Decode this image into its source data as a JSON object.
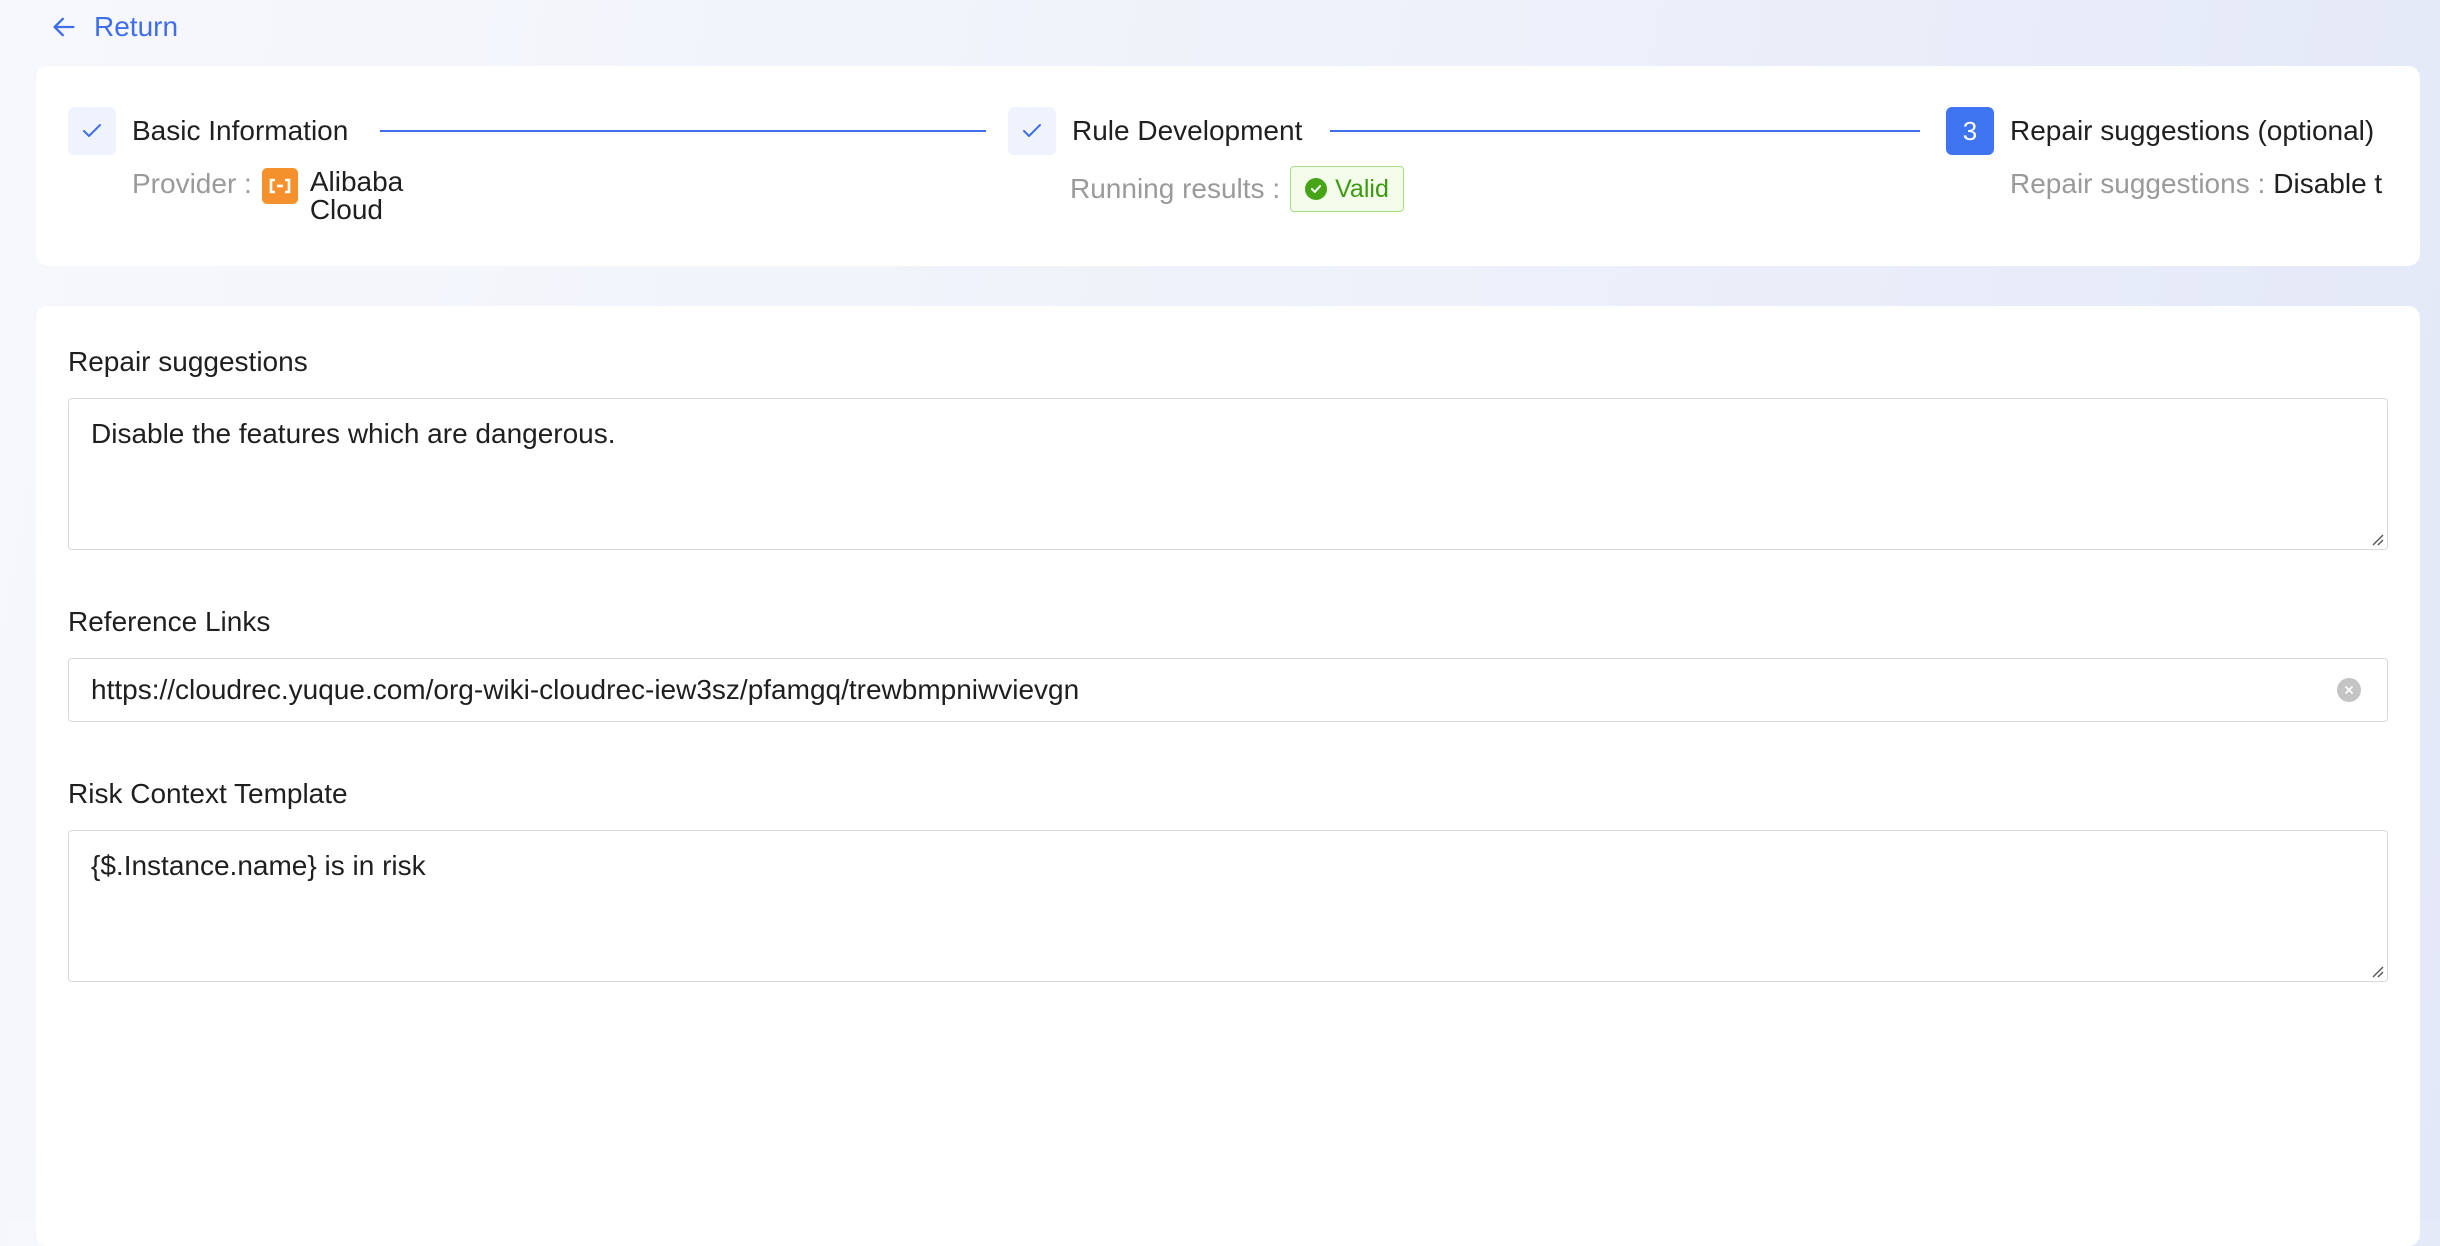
{
  "header": {
    "return_label": "Return"
  },
  "steps": [
    {
      "title": "Basic Information",
      "status": "done",
      "desc_label": "Provider :",
      "provider_line1": "Alibaba",
      "provider_line2": "Cloud"
    },
    {
      "title": "Rule Development",
      "status": "done",
      "desc_label": "Running results :",
      "result_tag": "Valid"
    },
    {
      "number": "3",
      "title": "Repair suggestions (optional)",
      "status": "active",
      "desc_label": "Repair suggestions :",
      "desc_value": "Disable the features which are dangerous."
    }
  ],
  "form": {
    "repair": {
      "label": "Repair suggestions",
      "value": "Disable the features which are dangerous."
    },
    "links": {
      "label": "Reference Links",
      "value": "https://cloudrec.yuque.com/org-wiki-cloudrec-iew3sz/pfamgq/trewbmpniwvievgn"
    },
    "risk": {
      "label": "Risk Context Template",
      "value": "{$.Instance.name} is in risk"
    }
  },
  "colors": {
    "accent": "#3f6ee8",
    "provider_brand": "#f5912c",
    "valid_green": "#46a417"
  }
}
